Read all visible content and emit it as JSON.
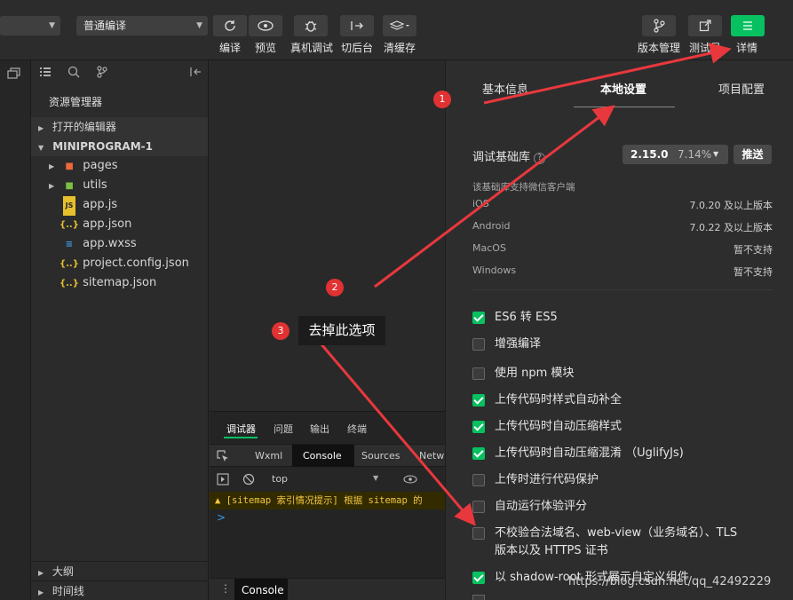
{
  "toolbar": {
    "mode_select": "",
    "compile_select": "普通编译",
    "buttons": {
      "compile": "编译",
      "preview": "预览",
      "remote_debug": "真机调试",
      "background": "切后台",
      "clear_cache": "清缓存",
      "version": "版本管理",
      "test": "测试号",
      "details": "详情"
    }
  },
  "explorer": {
    "title": "资源管理器",
    "open_editors": "打开的编辑器",
    "project": "MINIPROGRAM-1",
    "files": [
      {
        "name": "pages",
        "icon": "folder-red-icon"
      },
      {
        "name": "utils",
        "icon": "folder-green-icon"
      },
      {
        "name": "app.js",
        "icon": "js-file-icon"
      },
      {
        "name": "app.json",
        "icon": "json-file-icon"
      },
      {
        "name": "app.wxss",
        "icon": "css-file-icon"
      },
      {
        "name": "project.config.json",
        "icon": "json-file-icon"
      },
      {
        "name": "sitemap.json",
        "icon": "json-file-icon"
      }
    ],
    "outline": "大纲",
    "timeline": "时间线"
  },
  "details": {
    "tabs": [
      "基本信息",
      "本地设置",
      "项目配置"
    ],
    "active_tab": "本地设置",
    "lib": {
      "label": "调试基础库",
      "version": "2.15.0",
      "percent": "7.14%",
      "push": "推送",
      "support_title": "该基础库支持微信客户端",
      "platforms": [
        {
          "name": "iOS",
          "value": "7.0.20 及以上版本"
        },
        {
          "name": "Android",
          "value": "7.0.22 及以上版本"
        },
        {
          "name": "MacOS",
          "value": "暂不支持"
        },
        {
          "name": "Windows",
          "value": "暂不支持"
        }
      ]
    },
    "options": [
      {
        "label": "ES6 转 ES5",
        "checked": true
      },
      {
        "label": "增强编译",
        "checked": false
      },
      {
        "label": "使用 npm 模块",
        "checked": false
      },
      {
        "label": "上传代码时样式自动补全",
        "checked": true
      },
      {
        "label": "上传代码时自动压缩样式",
        "checked": true
      },
      {
        "label": "上传代码时自动压缩混淆 （UglifyJs)",
        "checked": true
      },
      {
        "label": "上传时进行代码保护",
        "checked": false
      },
      {
        "label": "自动运行体验评分",
        "checked": false
      },
      {
        "label": "不校验合法域名、web-view（业务域名）、TLS",
        "label2": "版本以及 HTTPS 证书",
        "checked": false
      },
      {
        "label": "以 shadow-root 形式展示自定义组件",
        "checked": true
      }
    ]
  },
  "devtools": {
    "tabs": [
      "调试器",
      "问题",
      "输出",
      "终端"
    ],
    "panels": [
      "Wxml",
      "Console",
      "Sources",
      "Netw"
    ],
    "context": "top",
    "warning": "[sitemap 索引情况提示] 根据 sitemap 的",
    "prompt": ">",
    "bottom_tab": "Console"
  },
  "annotations": {
    "markers": [
      "1",
      "2",
      "3"
    ],
    "note": "去掉此选项",
    "watermark": "https://blog.csdn.net/qq_42492229"
  },
  "colors": {
    "accent": "#07c160",
    "annotation": "#e03232"
  }
}
